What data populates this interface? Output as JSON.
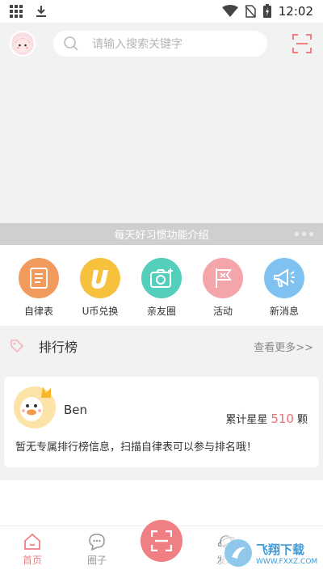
{
  "status_bar": {
    "time": "12:02",
    "icons": [
      "apps-grid-icon",
      "download-icon",
      "wifi-icon",
      "no-sim-icon",
      "battery-icon"
    ]
  },
  "header": {
    "search_placeholder": "请输入搜索关键字",
    "icons": [
      "avatar",
      "search-icon",
      "scan-icon"
    ]
  },
  "banner": {
    "caption": "每天好习惯功能介绍",
    "page_count": 3,
    "active_page": 0
  },
  "features": [
    {
      "label": "自律表",
      "icon": "document-icon",
      "color": "#f39a5d"
    },
    {
      "label": "U币兑换",
      "icon": "u-coin-icon",
      "color": "#f6c23e"
    },
    {
      "label": "亲友圈",
      "icon": "camera-icon",
      "color": "#54cfbc"
    },
    {
      "label": "活动",
      "icon": "flag-icon",
      "color": "#f4a5aa"
    },
    {
      "label": "新消息",
      "icon": "megaphone-icon",
      "color": "#7fc2f2"
    }
  ],
  "ranking": {
    "title": "排行榜",
    "more_label": "查看更多>>",
    "card": {
      "name": "Ben",
      "stars_prefix": "累计星星",
      "stars_value": "510",
      "stars_unit": "颗",
      "note": "暂无专属排行榜信息，扫描自律表可以参与排名哦！"
    }
  },
  "bottom_nav": {
    "items": [
      {
        "label": "首页",
        "icon": "home-icon",
        "active": true
      },
      {
        "label": "圈子",
        "icon": "chat-bubble-icon",
        "active": false
      },
      {
        "label": "",
        "icon": "scan-icon",
        "active": false
      },
      {
        "label": "发现",
        "icon": "planet-icon",
        "active": false
      }
    ]
  },
  "watermark": {
    "text": "飞翔下载",
    "url": "WWW.FXXZ.COM"
  },
  "colors": {
    "accent": "#f07f84",
    "stars_value": "#e27373"
  }
}
